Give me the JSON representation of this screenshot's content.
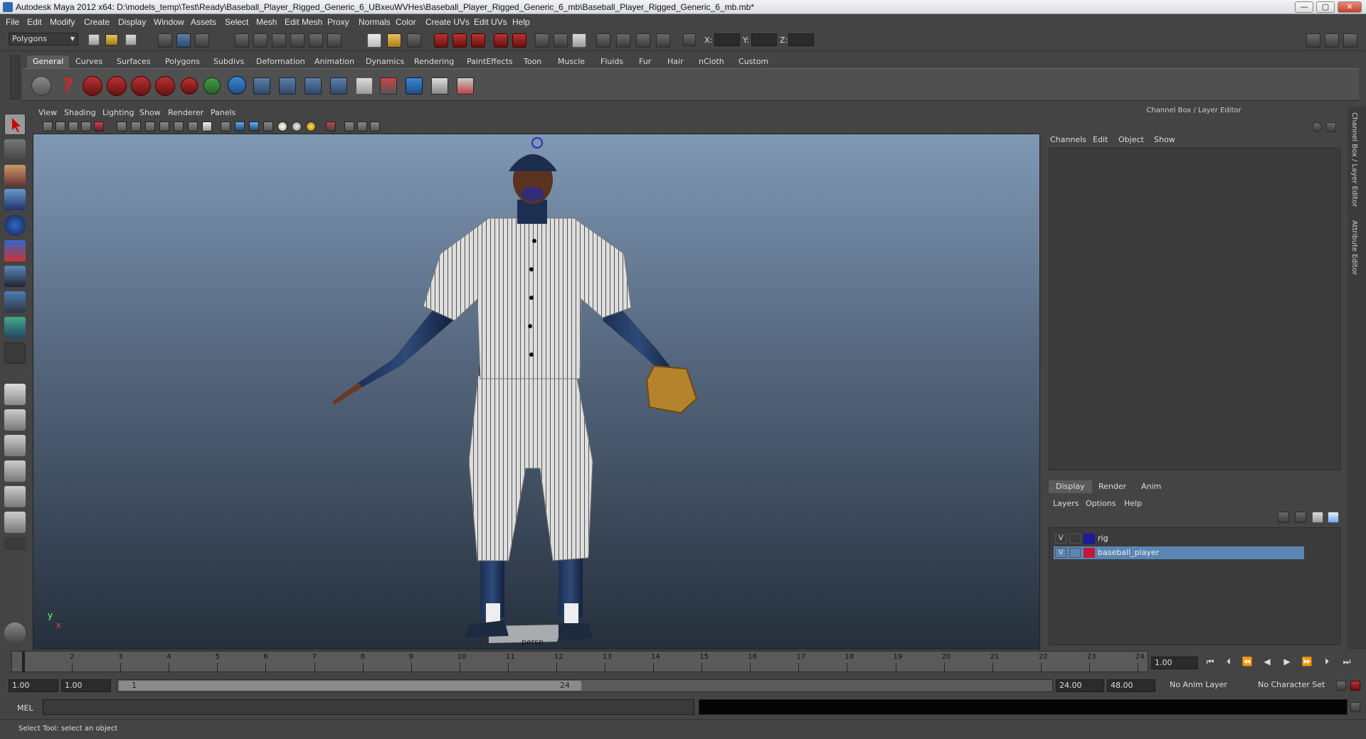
{
  "window": {
    "title": "Autodesk Maya 2012 x64: D:\\models_temp\\Test\\Ready\\Baseball_Player_Rigged_Generic_6_UBxeuWVHes\\Baseball_Player_Rigged_Generic_6_mb\\Baseball_Player_Rigged_Generic_6_mb.mb*",
    "minimize": "—",
    "maximize": "▢",
    "close": "✕"
  },
  "menubar": [
    "File",
    "Edit",
    "Modify",
    "Create",
    "Display",
    "Window",
    "Assets",
    "Select",
    "Mesh",
    "Edit Mesh",
    "Proxy",
    "Normals",
    "Color",
    "Create UVs",
    "Edit UVs",
    "Help"
  ],
  "statusline": {
    "menuset": "Polygons",
    "x_label": "X:",
    "y_label": "Y:",
    "z_label": "Z:"
  },
  "shelf": {
    "tabs": [
      "General",
      "Curves",
      "Surfaces",
      "Polygons",
      "Subdivs",
      "Deformation",
      "Animation",
      "Dynamics",
      "Rendering",
      "PaintEffects",
      "Toon",
      "Muscle",
      "Fluids",
      "Fur",
      "Hair",
      "nCloth",
      "Custom"
    ],
    "active_tab": "General"
  },
  "viewport": {
    "menu": [
      "View",
      "Shading",
      "Lighting",
      "Show",
      "Renderer",
      "Panels"
    ],
    "camera": "persp",
    "axis_y": "y",
    "axis_x": "x"
  },
  "channel_box": {
    "title": "Channel Box / Layer Editor",
    "menu": [
      "Channels",
      "Edit",
      "Object",
      "Show"
    ]
  },
  "layer_editor": {
    "tabs": [
      "Display",
      "Render",
      "Anim"
    ],
    "active_tab": "Display",
    "menu": [
      "Layers",
      "Options",
      "Help"
    ],
    "layers": [
      {
        "visible": "V",
        "name": "rig",
        "color": "#1a1aa0",
        "selected": false
      },
      {
        "visible": "V",
        "name": "baseball_player",
        "color": "#c0183a",
        "selected": true
      }
    ]
  },
  "side_tabs": [
    "Channel Box / Layer Editor",
    "Attribute Editor"
  ],
  "timeline": {
    "ticks": [
      "1",
      "2",
      "3",
      "4",
      "5",
      "6",
      "7",
      "8",
      "9",
      "10",
      "11",
      "12",
      "13",
      "14",
      "15",
      "16",
      "17",
      "18",
      "19",
      "20",
      "21",
      "22",
      "23",
      "24"
    ],
    "current_frame": "1.00"
  },
  "range": {
    "start": "1.00",
    "playback_start": "1.00",
    "slider_start": "1",
    "slider_end": "24",
    "playback_end": "24.00",
    "end": "48.00",
    "anim_layer": "No Anim Layer",
    "character_set": "No Character Set"
  },
  "command": {
    "label": "MEL"
  },
  "help_line": "Select Tool: select an object",
  "colors": {
    "ui_bg": "#444444",
    "selection": "#5b86b3",
    "viewport_top": "#7f98b4",
    "viewport_bottom": "#26303c"
  }
}
